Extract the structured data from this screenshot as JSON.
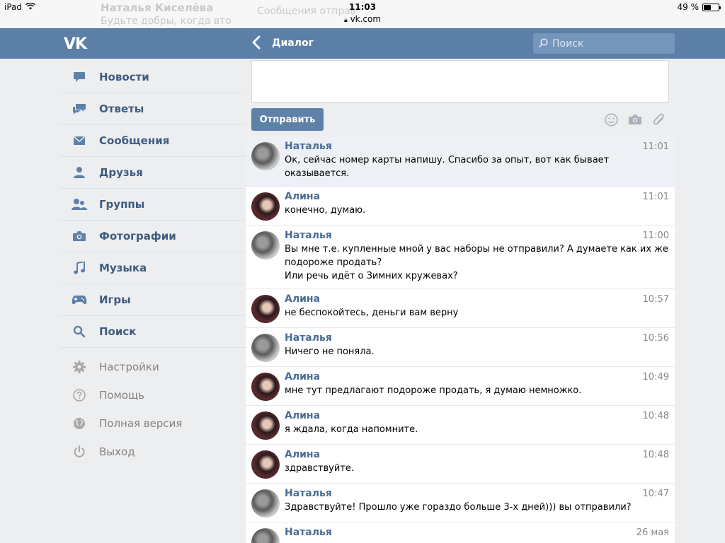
{
  "status_bar": {
    "device": "iPad",
    "time": "11:03",
    "url": "vk.com",
    "battery": "49 %",
    "battery_level": 0.49
  },
  "background_ghost": {
    "name": "Наталья Киселёва",
    "subtitle": "Будьте добры, когда вто",
    "snippet": "Сообщения отправ"
  },
  "header": {
    "logo": "VK",
    "title": "Диалог",
    "search_placeholder": "Поиск"
  },
  "sidebar": {
    "items": [
      {
        "label": "Новости",
        "icon": "news-icon"
      },
      {
        "label": "Ответы",
        "icon": "replies-icon"
      },
      {
        "label": "Сообщения",
        "icon": "envelope-icon"
      },
      {
        "label": "Друзья",
        "icon": "user-icon"
      },
      {
        "label": "Группы",
        "icon": "group-icon"
      },
      {
        "label": "Фотографии",
        "icon": "camera-icon"
      },
      {
        "label": "Музыка",
        "icon": "music-icon"
      },
      {
        "label": "Игры",
        "icon": "gamepad-icon"
      },
      {
        "label": "Поиск",
        "icon": "search-icon"
      }
    ],
    "secondary": [
      {
        "label": "Настройки",
        "icon": "gear-icon"
      },
      {
        "label": "Помощь",
        "icon": "help-icon"
      },
      {
        "label": "Полная версия",
        "icon": "globe-icon"
      },
      {
        "label": "Выход",
        "icon": "power-icon"
      }
    ]
  },
  "composer": {
    "send_label": "Отправить",
    "tools": [
      "emoji-icon",
      "camera-icon",
      "paperclip-icon"
    ]
  },
  "messages": [
    {
      "author": "Наталья",
      "time": "11:01",
      "text": "Ок, сейчас номер карты напишу. Спасибо за опыт, вот как бывает оказывается.",
      "highlight": true
    },
    {
      "author": "Алина",
      "time": "11:01",
      "text": "конечно, думаю."
    },
    {
      "author": "Наталья",
      "time": "11:00",
      "text": "Вы мне т.е. купленные мной у вас наборы не отправили? А думаете как их же подороже продать?\nИли речь идёт о Зимних кружевах?"
    },
    {
      "author": "Алина",
      "time": "10:57",
      "text": "не беспокойтесь, деньги вам верну"
    },
    {
      "author": "Наталья",
      "time": "10:56",
      "text": "Ничего не поняла."
    },
    {
      "author": "Алина",
      "time": "10:49",
      "text": "мне тут предлагают подороже продать, я думаю немножко."
    },
    {
      "author": "Алина",
      "time": "10:48",
      "text": "я ждала, когда напомните."
    },
    {
      "author": "Алина",
      "time": "10:48",
      "text": "здравствуйте."
    },
    {
      "author": "Наталья",
      "time": "10:47",
      "text": "Здравствуйте! Прошло уже гораздо больше 3-х дней))) вы отправили?"
    },
    {
      "author": "Наталья",
      "time": "26 мая",
      "text": ""
    }
  ],
  "colors": {
    "header": "#5b7fa6",
    "link": "#3f5c80",
    "button": "#5e81a8",
    "background": "#edeef0"
  }
}
